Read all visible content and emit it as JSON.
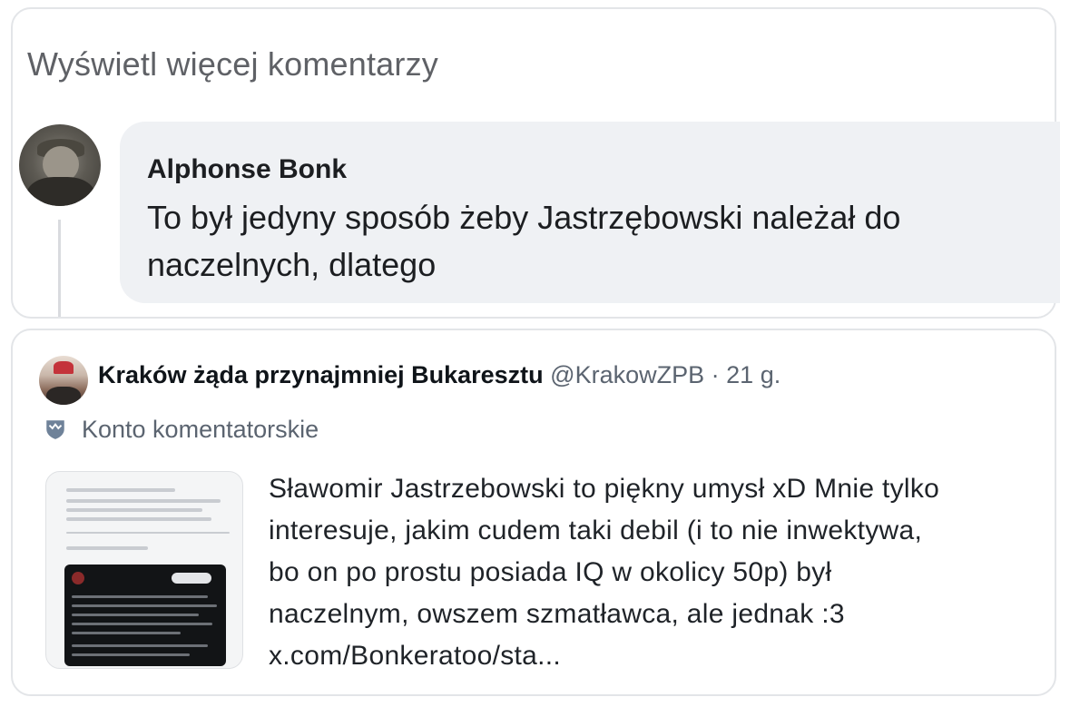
{
  "facebook": {
    "view_more_label": "Wyświetl więcej komentarzy",
    "comment": {
      "author": "Alphonse Bonk",
      "text": "To był jedyny sposób żeby Jastrzębowski należał do naczelnych, dlatego"
    }
  },
  "tweet": {
    "author_name": "Kraków żąda przynajmniej Bukaresztu",
    "handle": "@KrakowZPB",
    "separator": "·",
    "time": "21 g.",
    "account_type": "Konto komentatorskie",
    "account_icon": "shield-icon",
    "text_lines": [
      "Sławomir Jastrzebowski to piękny umysł xD Mnie tylko",
      "interesuje, jakim cudem taki debil (i to nie inwektywa,",
      "bo on po prostu posiada IQ w okolicy 50p) był",
      "naczelnym, owszem szmatławca, ale jednak :3",
      "x.com/Bonkeratoo/sta..."
    ]
  },
  "colors": {
    "bubble_bg": "#eff1f4",
    "card_border": "#e3e5e8",
    "secondary_text": "#5b6470"
  }
}
